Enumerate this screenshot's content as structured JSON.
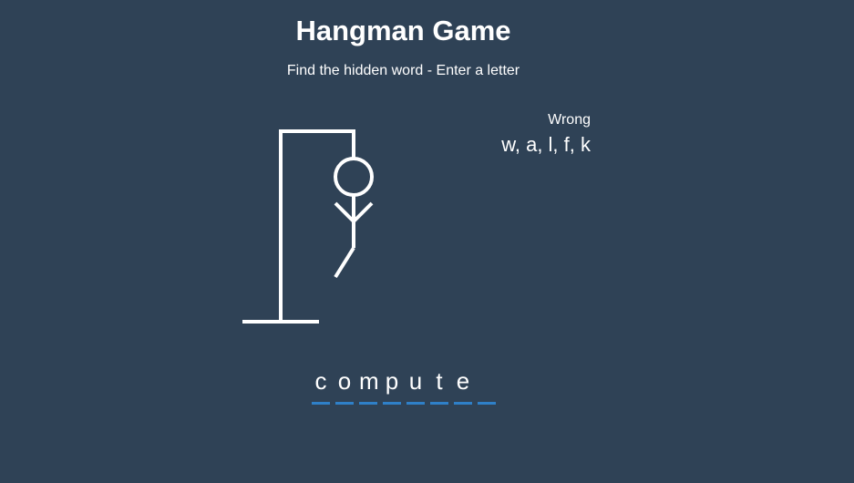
{
  "game": {
    "title": "Hangman Game",
    "subtitle": "Find the hidden word - Enter a letter"
  },
  "wrong": {
    "label": "Wrong",
    "letters": "w, a, l, f, k"
  },
  "word": {
    "slots": [
      "c",
      "o",
      "m",
      "p",
      "u",
      "t",
      "e",
      ""
    ]
  },
  "colors": {
    "background": "#2f4256",
    "ink": "#ffffff",
    "dash": "#2f80c8"
  },
  "figure": {
    "parts_shown": [
      "head",
      "body",
      "left-arm",
      "right-arm",
      "left-leg"
    ],
    "parts_total": 6
  }
}
